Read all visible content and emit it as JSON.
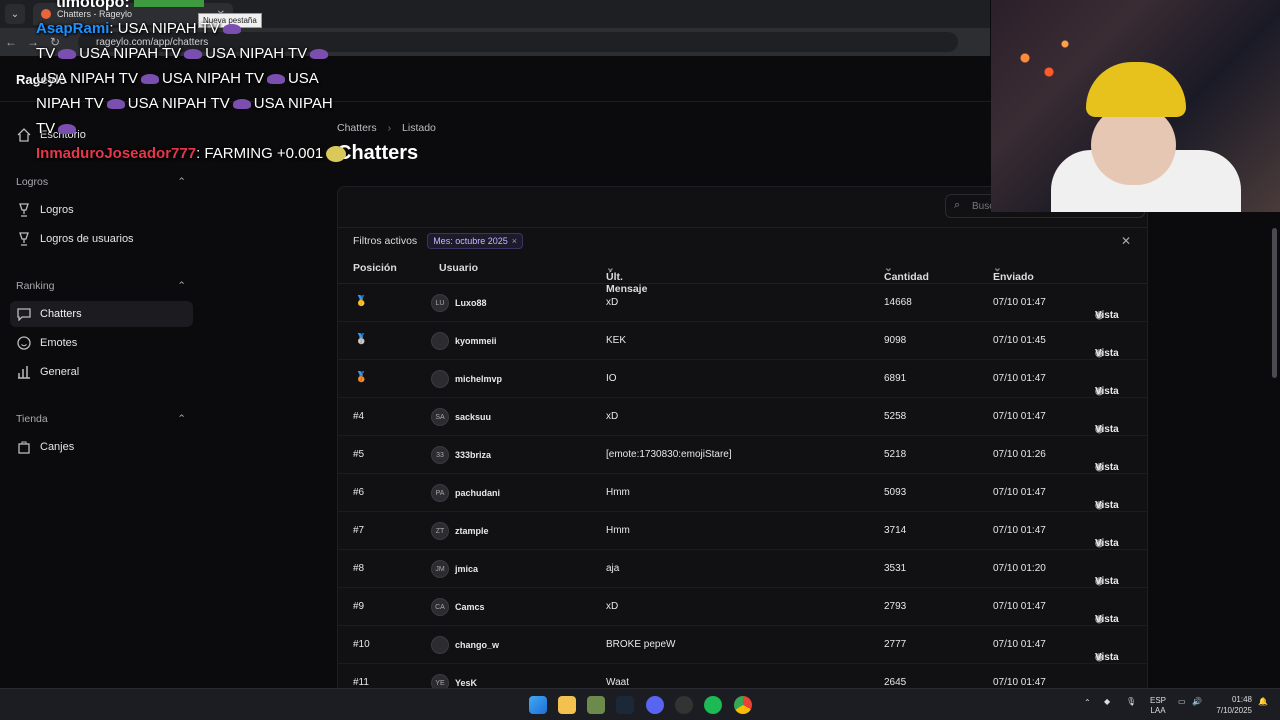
{
  "browser": {
    "tab_title": "Chatters - Rageylo",
    "tooltip": "Nueva pestaña",
    "url": "rageylo.com/app/chatters"
  },
  "app": {
    "brand": "Rageylo"
  },
  "sidebar": {
    "escritorio": "Escritorio",
    "logros_section": "Logros",
    "logros": "Logros",
    "logros_usuarios": "Logros de usuarios",
    "ranking_section": "Ranking",
    "chatters": "Chatters",
    "emotes": "Emotes",
    "general": "General",
    "tienda_section": "Tienda",
    "canjes": "Canjes"
  },
  "breadcrumb": {
    "root": "Chatters",
    "current": "Listado"
  },
  "page_title": "Chatters",
  "search_placeholder": "Busc",
  "filters": {
    "label": "Filtros activos",
    "chip": "Mes: octubre 2025"
  },
  "table": {
    "headers": {
      "pos": "Posición",
      "user": "Usuario",
      "msg": "Últ. Mensaje",
      "qty": "Cantidad",
      "sent": "Enviado"
    },
    "view_label": "Vista",
    "rows": [
      {
        "pos": "",
        "medal": "🥇",
        "avatar": "LU",
        "user": "Luxo88",
        "msg": "xD",
        "qty": "14668",
        "sent": "07/10 01:47"
      },
      {
        "pos": "",
        "medal": "🥈",
        "avatar": "",
        "user": "kyommeii",
        "msg": "KEK",
        "qty": "9098",
        "sent": "07/10 01:45"
      },
      {
        "pos": "",
        "medal": "🥉",
        "avatar": "",
        "user": "michelmvp",
        "msg": "IO",
        "qty": "6891",
        "sent": "07/10 01:47"
      },
      {
        "pos": "#4",
        "medal": "",
        "avatar": "SA",
        "user": "sacksuu",
        "msg": "xD",
        "qty": "5258",
        "sent": "07/10 01:47"
      },
      {
        "pos": "#5",
        "medal": "",
        "avatar": "33",
        "user": "333briza",
        "msg": "[emote:1730830:emojiStare]",
        "qty": "5218",
        "sent": "07/10 01:26"
      },
      {
        "pos": "#6",
        "medal": "",
        "avatar": "PA",
        "user": "pachudani",
        "msg": "Hmm",
        "qty": "5093",
        "sent": "07/10 01:47"
      },
      {
        "pos": "#7",
        "medal": "",
        "avatar": "ZT",
        "user": "ztample",
        "msg": "Hmm",
        "qty": "3714",
        "sent": "07/10 01:47"
      },
      {
        "pos": "#8",
        "medal": "",
        "avatar": "JM",
        "user": "jmica",
        "msg": "aja",
        "qty": "3531",
        "sent": "07/10 01:20"
      },
      {
        "pos": "#9",
        "medal": "",
        "avatar": "CA",
        "user": "Camcs",
        "msg": "xD",
        "qty": "2793",
        "sent": "07/10 01:47"
      },
      {
        "pos": "#10",
        "medal": "",
        "avatar": "",
        "user": "chango_w",
        "msg": "BROKE pepeW",
        "qty": "2777",
        "sent": "07/10 01:47"
      },
      {
        "pos": "#11",
        "medal": "",
        "avatar": "YE",
        "user": "YesK",
        "msg": "Waat",
        "qty": "2645",
        "sent": "07/10 01:47"
      }
    ]
  },
  "overlay_chat": {
    "top_user": "timotopo:",
    "line1_user": "AsapRami",
    "line1_text": ": USA NIPAH TV",
    "line1b": "TV",
    "line1c": "USA NIPAH TV",
    "line1d": "USA NIPAH TV",
    "line2": "USA NIPAH TV",
    "line2b": "USA NIPAH TV",
    "line2c": "USA",
    "line3": "NIPAH TV",
    "line3b": "USA NIPAH TV",
    "line3c": "USA NIPAH",
    "line4": "TV",
    "line5_user": "InmaduroJoseador777",
    "line5_text": ": FARMING +0.001"
  },
  "taskbar": {
    "lang": "ESP",
    "lang2": "LAA",
    "time": "01:48",
    "date": "7/10/2025"
  }
}
